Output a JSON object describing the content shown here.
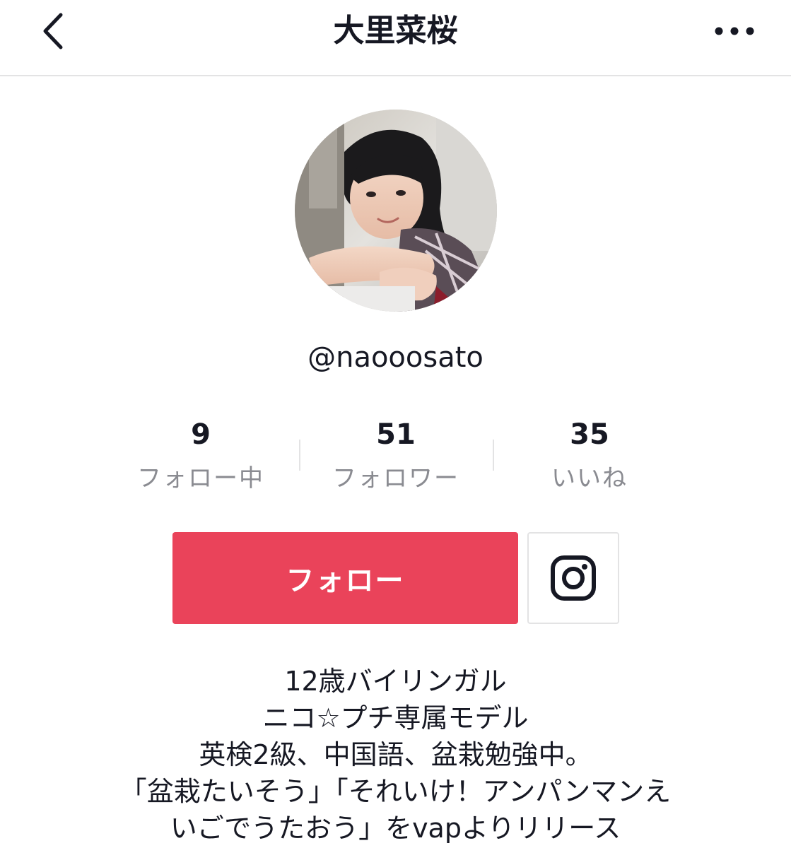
{
  "header": {
    "title": "大里菜桜",
    "back_icon": "chevron-left-icon",
    "more_icon": "ellipsis-icon"
  },
  "profile": {
    "avatar": "profile-photo",
    "username": "@naooosato"
  },
  "stats": [
    {
      "value": "9",
      "label": "フォロー中"
    },
    {
      "value": "51",
      "label": "フォロワー"
    },
    {
      "value": "35",
      "label": "いいね"
    }
  ],
  "actions": {
    "follow_label": "フォロー",
    "follow_color": "#ea435a",
    "instagram_icon": "instagram-icon"
  },
  "bio": [
    "12歳バイリンガル",
    "ニコ☆プチ専属モデル",
    "英検2級、中国語、盆栽勉強中。",
    "「盆栽たいそう」「それいけ！アンパンマンえ",
    "いごでうたおう」をvapよりリリース"
  ]
}
